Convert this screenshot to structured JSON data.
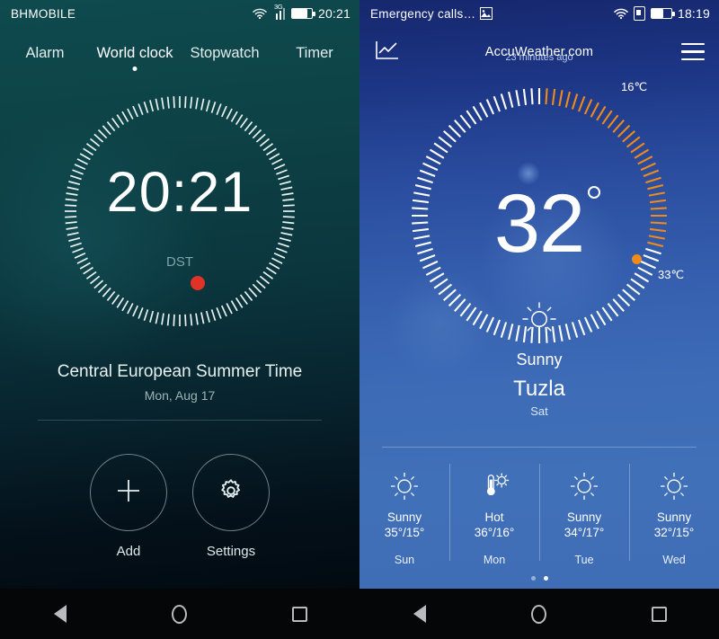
{
  "clock_app": {
    "statusbar": {
      "carrier": "BHMOBILE",
      "network": "3G",
      "time": "20:21"
    },
    "tabs": [
      {
        "label": "Alarm",
        "active": false
      },
      {
        "label": "World clock",
        "active": true
      },
      {
        "label": "Stopwatch",
        "active": false
      },
      {
        "label": "Timer",
        "active": false
      }
    ],
    "dial": {
      "time": "20:21",
      "dst_label": "DST"
    },
    "timezone_name": "Central European Summer Time",
    "date": "Mon, Aug 17",
    "actions": [
      {
        "label": "Add",
        "icon": "plus-icon"
      },
      {
        "label": "Settings",
        "icon": "gear-icon"
      }
    ]
  },
  "weather_app": {
    "statusbar": {
      "carrier": "Emergency calls…",
      "time": "18:19"
    },
    "header": {
      "title": "AccuWeather.com",
      "subtitle": "23 minutes ago"
    },
    "dial": {
      "temperature": "32",
      "high_label": "16℃",
      "low_label": "33℃",
      "arc_color": "#f08a1a"
    },
    "current": {
      "condition": "Sunny",
      "city": "Tuzla",
      "day": "Sat",
      "icon": "sun-icon"
    },
    "forecast": [
      {
        "condition": "Sunny",
        "temps": "35°/15°",
        "day": "Sun",
        "icon": "sun-icon"
      },
      {
        "condition": "Hot",
        "temps": "36°/16°",
        "day": "Mon",
        "icon": "thermometer-sun-icon"
      },
      {
        "condition": "Sunny",
        "temps": "34°/17°",
        "day": "Tue",
        "icon": "sun-icon"
      },
      {
        "condition": "Sunny",
        "temps": "32°/15°",
        "day": "Wed",
        "icon": "sun-icon"
      }
    ],
    "page_dots": {
      "count": 2,
      "active_index": 1
    }
  },
  "navbar": {
    "back": "back-button",
    "home": "home-button",
    "recents": "recents-button"
  }
}
